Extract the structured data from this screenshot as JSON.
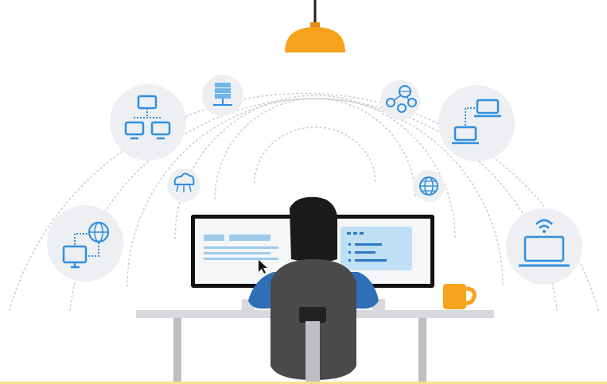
{
  "scene": {
    "description_icons": [
      "network-topology-icon",
      "server-network-icon",
      "cloud-network-icon",
      "globe-network-icon",
      "laptop-connection-icon",
      "globe-icon",
      "desktop-globe-icon",
      "wifi-laptop-icon"
    ]
  },
  "colors": {
    "lamp": "#F7A21B",
    "lamp_cord": "#1f1f1f",
    "icon_blue": "#2E8FE0",
    "icon_circle": "#EDEFF2",
    "arc_dots": "#C9CDD2",
    "monitor_frame": "#111111",
    "screen_bg": "#F4F6F8",
    "screen_bar": "#9DCBEB",
    "panel_bg": "#BFDFF4",
    "panel_line": "#2A78C2",
    "hair": "#1a1a1a",
    "skin": "#F4B183",
    "shirt": "#2F6FB8",
    "chair": "#4A4A4A",
    "chair_dark": "#222222",
    "desk": "#D7D9DC",
    "desk_leg": "#BDBFC2",
    "mug": "#F7A21B",
    "bottom_line": "#F5E38A"
  }
}
